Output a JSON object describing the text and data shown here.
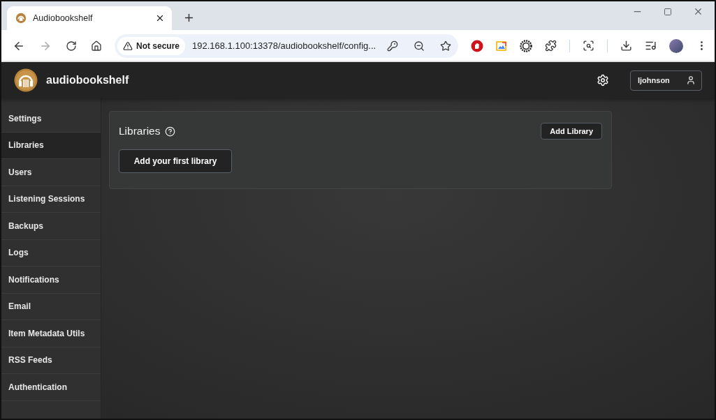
{
  "browser": {
    "tab_title": "Audiobookshelf",
    "security_label": "Not secure",
    "url": "192.168.1.100:13378/audiobookshelf/config..."
  },
  "header": {
    "app_name": "audiobookshelf",
    "username": "ljohnson"
  },
  "sidebar": {
    "items": [
      {
        "label": "Settings",
        "selected": false
      },
      {
        "label": "Libraries",
        "selected": true
      },
      {
        "label": "Users",
        "selected": false
      },
      {
        "label": "Listening Sessions",
        "selected": false
      },
      {
        "label": "Backups",
        "selected": false
      },
      {
        "label": "Logs",
        "selected": false
      },
      {
        "label": "Notifications",
        "selected": false
      },
      {
        "label": "Email",
        "selected": false
      },
      {
        "label": "Item Metadata Utils",
        "selected": false
      },
      {
        "label": "RSS Feeds",
        "selected": false
      },
      {
        "label": "Authentication",
        "selected": false
      }
    ]
  },
  "panel": {
    "title": "Libraries",
    "add_button": "Add Library",
    "first_library_button": "Add your first library"
  }
}
